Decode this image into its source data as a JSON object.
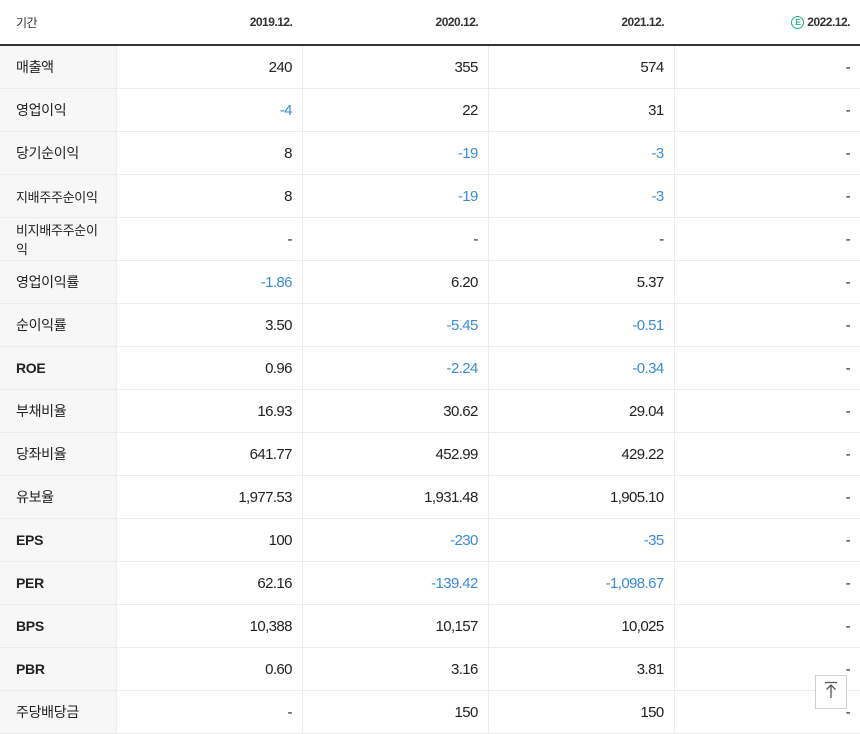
{
  "header": {
    "period_label": "기간",
    "columns": [
      "2019.12.",
      "2020.12.",
      "2021.12.",
      "2022.12."
    ],
    "estimate_icon": "e-estimate-icon",
    "estimate_letter": "E"
  },
  "rows": [
    {
      "label": "매출액",
      "values": [
        "240",
        "355",
        "574",
        "-"
      ]
    },
    {
      "label": "영업이익",
      "values": [
        "-4",
        "22",
        "31",
        "-"
      ]
    },
    {
      "label": "당기순이익",
      "values": [
        "8",
        "-19",
        "-3",
        "-"
      ]
    },
    {
      "label": "지배주주순이익",
      "values": [
        "8",
        "-19",
        "-3",
        "-"
      ]
    },
    {
      "label": "비지배주주순이익",
      "values": [
        "-",
        "-",
        "-",
        "-"
      ]
    },
    {
      "label": "영업이익률",
      "values": [
        "-1.86",
        "6.20",
        "5.37",
        "-"
      ]
    },
    {
      "label": "순이익률",
      "values": [
        "3.50",
        "-5.45",
        "-0.51",
        "-"
      ]
    },
    {
      "label": "ROE",
      "values": [
        "0.96",
        "-2.24",
        "-0.34",
        "-"
      ]
    },
    {
      "label": "부채비율",
      "values": [
        "16.93",
        "30.62",
        "29.04",
        "-"
      ]
    },
    {
      "label": "당좌비율",
      "values": [
        "641.77",
        "452.99",
        "429.22",
        "-"
      ]
    },
    {
      "label": "유보율",
      "values": [
        "1,977.53",
        "1,931.48",
        "1,905.10",
        "-"
      ]
    },
    {
      "label": "EPS",
      "values": [
        "100",
        "-230",
        "-35",
        "-"
      ]
    },
    {
      "label": "PER",
      "values": [
        "62.16",
        "-139.42",
        "-1,098.67",
        "-"
      ]
    },
    {
      "label": "BPS",
      "values": [
        "10,388",
        "10,157",
        "10,025",
        "-"
      ]
    },
    {
      "label": "PBR",
      "values": [
        "0.60",
        "3.16",
        "3.81",
        "-"
      ]
    },
    {
      "label": "주당배당금",
      "values": [
        "-",
        "150",
        "150",
        "-"
      ]
    }
  ],
  "colors": {
    "negative": "#3a8bd6",
    "label_bg": "#f7f7f7",
    "estimate": "#1fb37a"
  },
  "scroll_top_icon": "arrow-up-to-top-icon"
}
